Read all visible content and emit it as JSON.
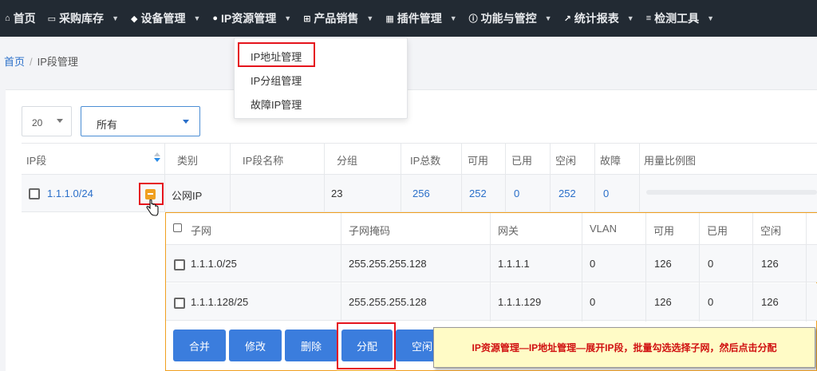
{
  "nav": {
    "items": [
      {
        "label": "首页",
        "icon": "home-icon",
        "glyph": "⌂"
      },
      {
        "label": "采购库存",
        "icon": "inbox-icon",
        "glyph": "▭"
      },
      {
        "label": "设备管理",
        "icon": "cube-icon",
        "glyph": "◆"
      },
      {
        "label": "IP资源管理",
        "icon": "map-marker-icon",
        "glyph": "●"
      },
      {
        "label": "产品销售",
        "icon": "cart-icon",
        "glyph": "⊞"
      },
      {
        "label": "插件管理",
        "icon": "grid-icon",
        "glyph": "▦"
      },
      {
        "label": "功能与管控",
        "icon": "info-circle-icon",
        "glyph": "ⓘ"
      },
      {
        "label": "统计报表",
        "icon": "line-chart-icon",
        "glyph": "↗"
      },
      {
        "label": "检测工具",
        "icon": "list-icon",
        "glyph": "≡"
      }
    ]
  },
  "dropdown": {
    "items": [
      "IP地址管理",
      "IP分组管理",
      "故障IP管理"
    ]
  },
  "breadcrumb": {
    "home": "首页",
    "sep": "/",
    "current": "IP段管理"
  },
  "controls": {
    "page_size": "20",
    "filter": "所有"
  },
  "table": {
    "headers": [
      "IP段",
      "类别",
      "IP段名称",
      "分组",
      "IP总数",
      "可用",
      "已用",
      "空闲",
      "故障",
      "用量比例图"
    ],
    "row": {
      "segment": "1.1.1.0/24",
      "category": "公网IP",
      "name": "",
      "group": "23",
      "total": "256",
      "available": "252",
      "used": "0",
      "free": "252",
      "fault": "0"
    }
  },
  "subtable": {
    "headers": [
      "子网",
      "子网掩码",
      "网关",
      "VLAN",
      "可用",
      "已用",
      "空闲"
    ],
    "rows": [
      {
        "subnet": "1.1.1.0/25",
        "mask": "255.255.255.128",
        "gateway": "1.1.1.1",
        "vlan": "0",
        "available": "126",
        "used": "0",
        "free": "126"
      },
      {
        "subnet": "1.1.1.128/25",
        "mask": "255.255.255.128",
        "gateway": "1.1.1.129",
        "vlan": "0",
        "available": "126",
        "used": "0",
        "free": "126"
      }
    ]
  },
  "actions": {
    "merge": "合并",
    "edit": "修改",
    "delete": "删除",
    "assign": "分配",
    "idle": "空闲"
  },
  "annotation": "IP资源管理—IP地址管理—展开IP段，批量勾选选择子网，然后点击分配",
  "colors": {
    "nav_bg": "#222a33",
    "accent": "#3b7ddd",
    "link": "#2a6fc9",
    "highlight": "#e5141c",
    "expand": "#f0a020",
    "note_bg": "#fffbc6"
  }
}
